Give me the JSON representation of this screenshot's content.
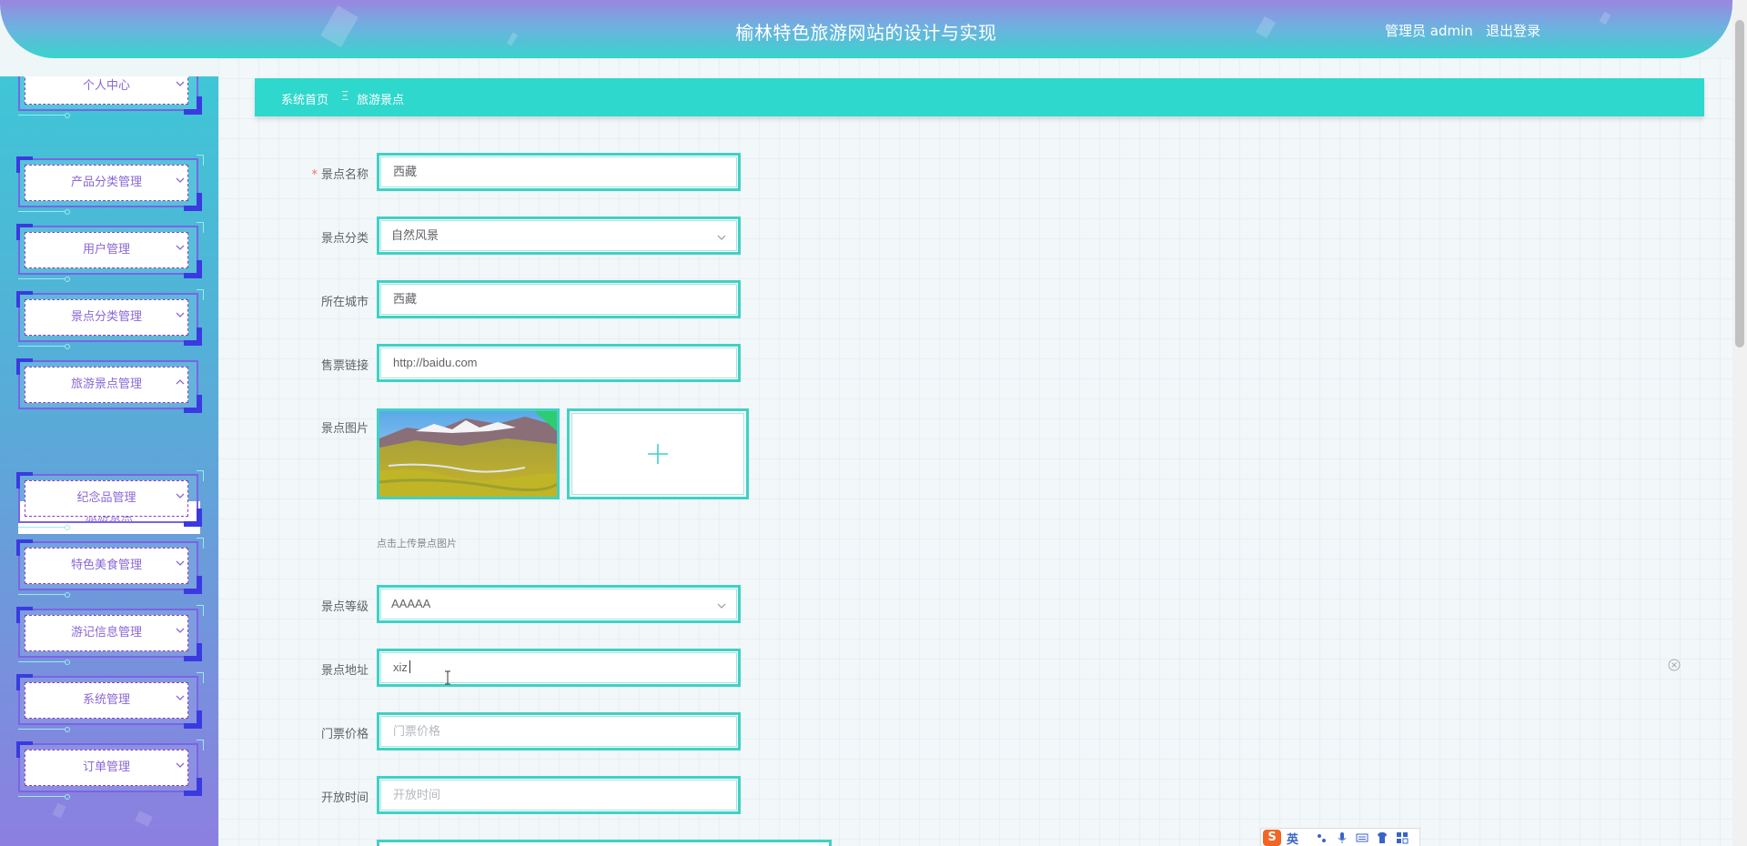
{
  "header": {
    "title": "榆林特色旅游网站的设计与实现",
    "user": "管理员 admin",
    "logout": "退出登录"
  },
  "sidebar": {
    "items": [
      {
        "label": "个人中心",
        "expanded": false
      },
      {
        "label": "产品分类管理",
        "expanded": false
      },
      {
        "label": "用户管理",
        "expanded": false
      },
      {
        "label": "景点分类管理",
        "expanded": false
      },
      {
        "label": "旅游景点管理",
        "expanded": true
      },
      {
        "label": "纪念品管理",
        "expanded": false
      },
      {
        "label": "特色美食管理",
        "expanded": false
      },
      {
        "label": "游记信息管理",
        "expanded": false
      },
      {
        "label": "系统管理",
        "expanded": false
      },
      {
        "label": "订单管理",
        "expanded": false
      }
    ],
    "submenu": {
      "label": "旅游景点"
    }
  },
  "breadcrumb": {
    "home": "系统首页",
    "separator": "Ξ",
    "current": "旅游景点"
  },
  "form": {
    "name": {
      "label": "景点名称",
      "required_mark": "*",
      "value": "西藏"
    },
    "category": {
      "label": "景点分类",
      "value": "自然风景"
    },
    "city": {
      "label": "所在城市",
      "value": "西藏"
    },
    "ticket_link": {
      "label": "售票链接",
      "value": "http://baidu.com"
    },
    "image": {
      "label": "景点图片",
      "hint": "点击上传景点图片"
    },
    "level": {
      "label": "景点等级",
      "value": "AAAAA"
    },
    "address": {
      "label": "景点地址",
      "value": "xiz"
    },
    "price": {
      "label": "门票价格",
      "placeholder": "门票价格"
    },
    "open_time": {
      "label": "开放时间",
      "placeholder": "开放时间"
    }
  },
  "ime": {
    "logo": "S",
    "lang": "英"
  },
  "colors": {
    "accent": "#2fd8cc",
    "menu_text": "#8a67d6",
    "menu_border": "#7b63e6",
    "required": "#f56c6c"
  }
}
